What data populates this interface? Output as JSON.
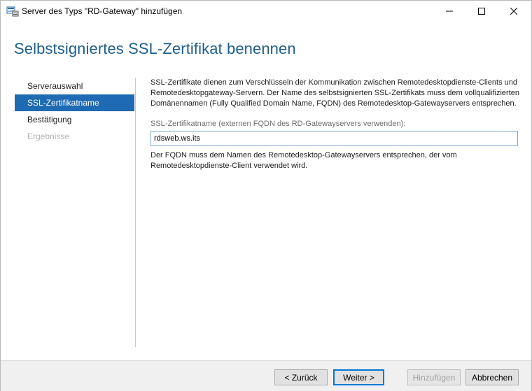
{
  "window": {
    "title": "Server des Typs \"RD-Gateway\" hinzufügen",
    "icon": "server-manager-icon"
  },
  "header": {
    "title": "Selbstsigniertes SSL-Zertifikat benennen"
  },
  "nav": {
    "items": [
      {
        "label": "Serverauswahl",
        "state": "normal"
      },
      {
        "label": "SSL-Zertifikatname",
        "state": "active"
      },
      {
        "label": "Bestätigung",
        "state": "normal"
      },
      {
        "label": "Ergebnisse",
        "state": "disabled"
      }
    ]
  },
  "content": {
    "description": "SSL-Zertifikate dienen zum Verschlüsseln der Kommunikation zwischen Remotedesktopdienste-Clients und Remotedesktopgateway-Servern. Der Name des selbstsignierten SSL-Zertifikats muss dem vollqualifizierten Domänennamen (Fully Qualified Domain Name, FQDN) des Remotedesktop-Gatewayservers entsprechen.",
    "field_label": "SSL-Zertifikatname (externen FQDN des RD-Gatewayservers verwenden):",
    "field_value": "rdsweb.ws.its",
    "note": "Der FQDN muss dem Namen des Remotedesktop-Gatewayservers entsprechen, der vom Remotedesktopdienste-Client verwendet wird."
  },
  "footer": {
    "back_label": "< Zurück",
    "next_label": "Weiter >",
    "add_label": "Hinzufügen",
    "cancel_label": "Abbrechen"
  },
  "colors": {
    "accent": "#1e6ab3",
    "title": "#1e5f8c",
    "disabled_text": "#b3b3b3"
  }
}
